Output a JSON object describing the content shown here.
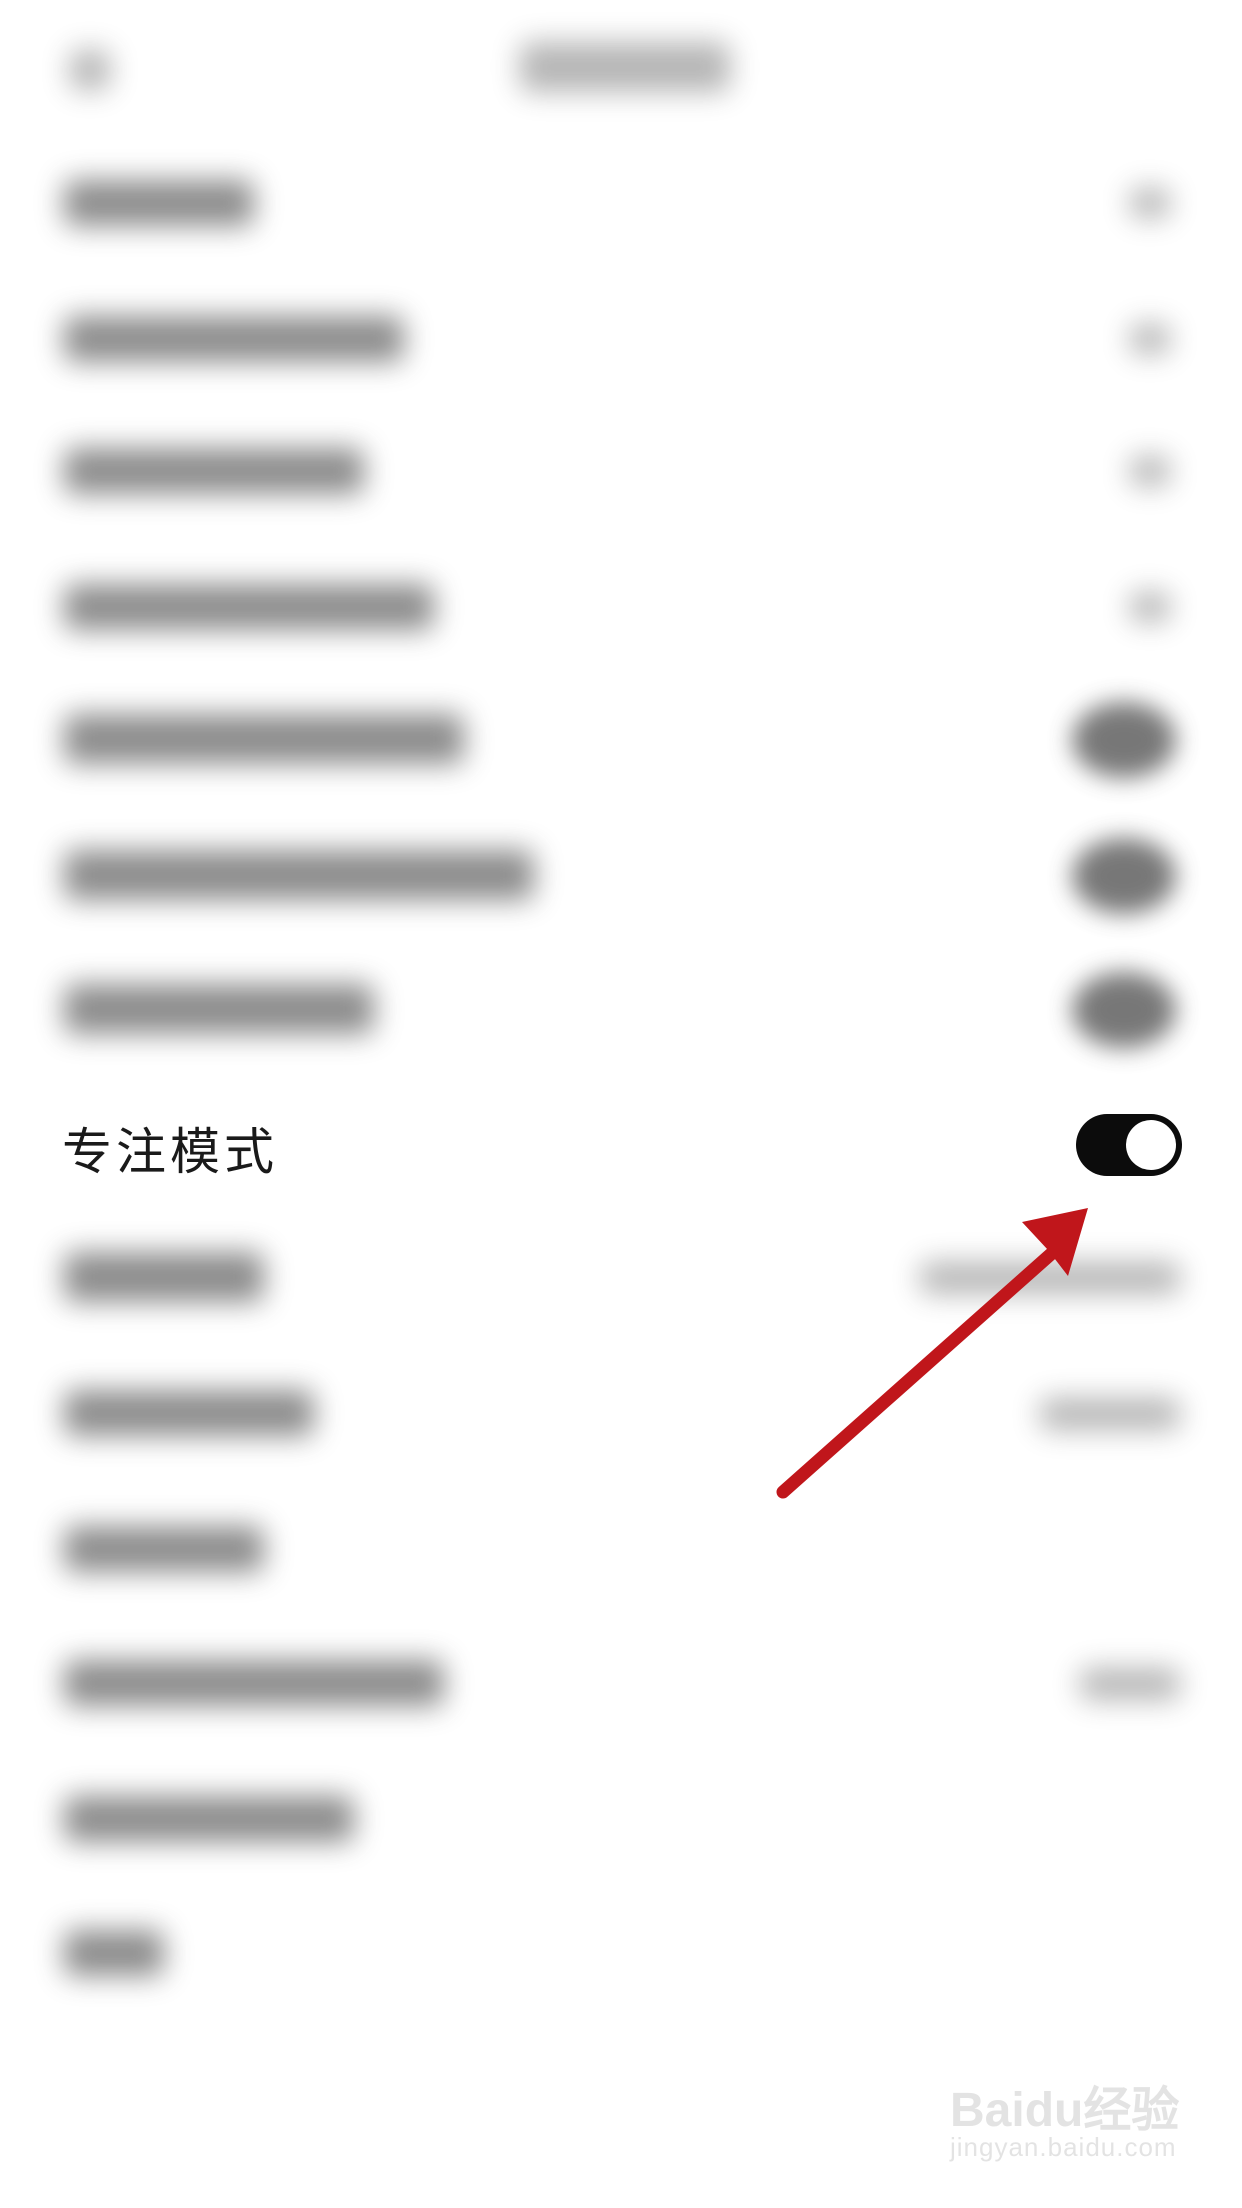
{
  "settings": {
    "focus_mode": {
      "label": "专注模式",
      "enabled": true
    }
  },
  "watermark": {
    "brand": "Baidu经验",
    "url": "jingyan.baidu.com"
  },
  "colors": {
    "toggle_on": "#0c0c0c",
    "arrow": "#c0161b"
  }
}
